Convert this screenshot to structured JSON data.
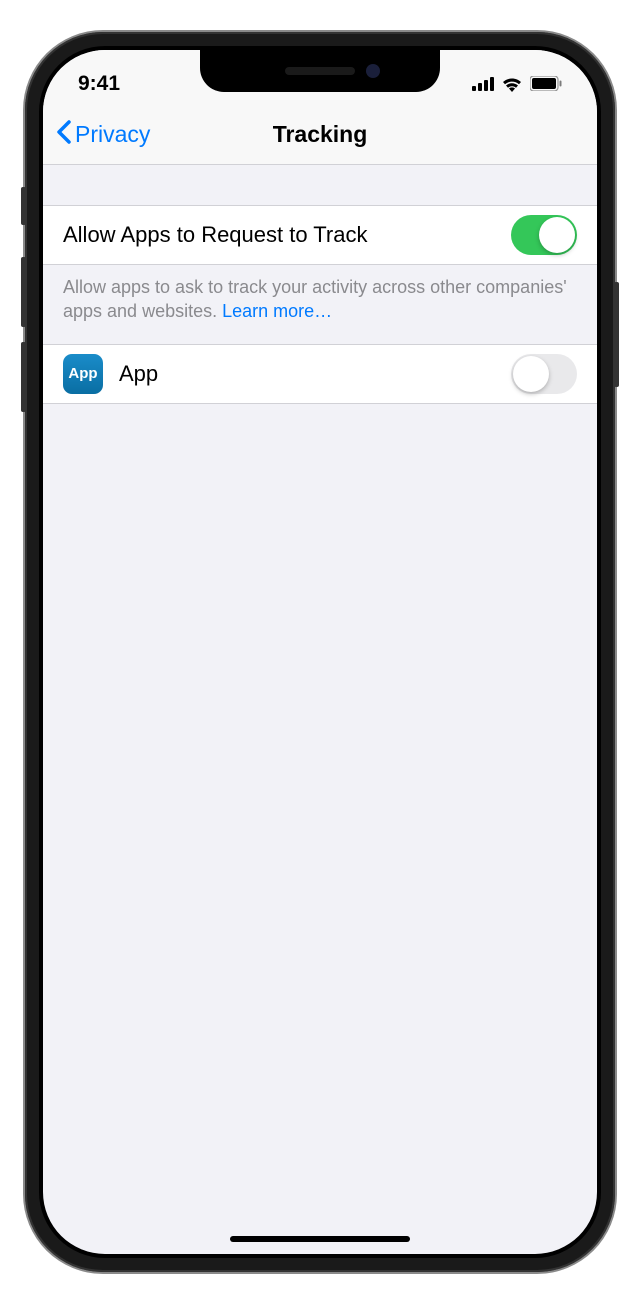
{
  "status": {
    "time": "9:41"
  },
  "nav": {
    "back_label": "Privacy",
    "title": "Tracking"
  },
  "main": {
    "allow_label": "Allow Apps to Request to Track",
    "allow_enabled": true,
    "footer_text": "Allow apps to ask to track your activity across other companies' apps and websites. ",
    "learn_more": "Learn more…"
  },
  "apps": [
    {
      "icon_text": "App",
      "name": "App",
      "enabled": false
    }
  ]
}
